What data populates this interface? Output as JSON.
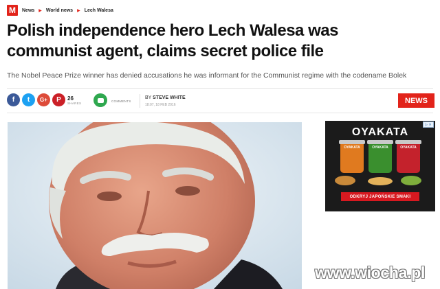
{
  "site": {
    "logo_letter": "M"
  },
  "breadcrumb": [
    "News",
    "World news",
    "Lech Walesa"
  ],
  "article": {
    "headline": "Polish independence hero Lech Walesa was communist agent, claims secret police file",
    "standfirst": "The Nobel Peace Prize winner has denied accusations he was informant for the Communist regime with the codename Bolek",
    "share_count": "26",
    "shares_label": "SHARES",
    "comments_label": "COMMENTS",
    "byline_prefix": "BY",
    "author": "STEVE WHITE",
    "dateline": "18:07, 18 FEB 2016",
    "section_badge": "NEWS"
  },
  "share_buttons": [
    {
      "name": "facebook",
      "glyph": "f",
      "color": "#3b5998"
    },
    {
      "name": "twitter",
      "glyph": "t",
      "color": "#1da1f2"
    },
    {
      "name": "google-plus",
      "glyph": "G+",
      "color": "#dd4b39"
    },
    {
      "name": "pinterest",
      "glyph": "P",
      "color": "#cb2027"
    }
  ],
  "ad": {
    "brand": "OYAKATA",
    "cup_labels": [
      "OYAKATA",
      "OYAKATA",
      "OYAKATA"
    ],
    "cup_colors": [
      "#e07a1f",
      "#3a8f2e",
      "#c4222c"
    ],
    "cta": "ODKRYJ JAPOŃSKIE SMAKI",
    "corner": "▷ ✕"
  },
  "watermark": "www.wiocha.pl",
  "colors": {
    "brand_red": "#e2231a",
    "comment_green": "#2fa84f"
  }
}
